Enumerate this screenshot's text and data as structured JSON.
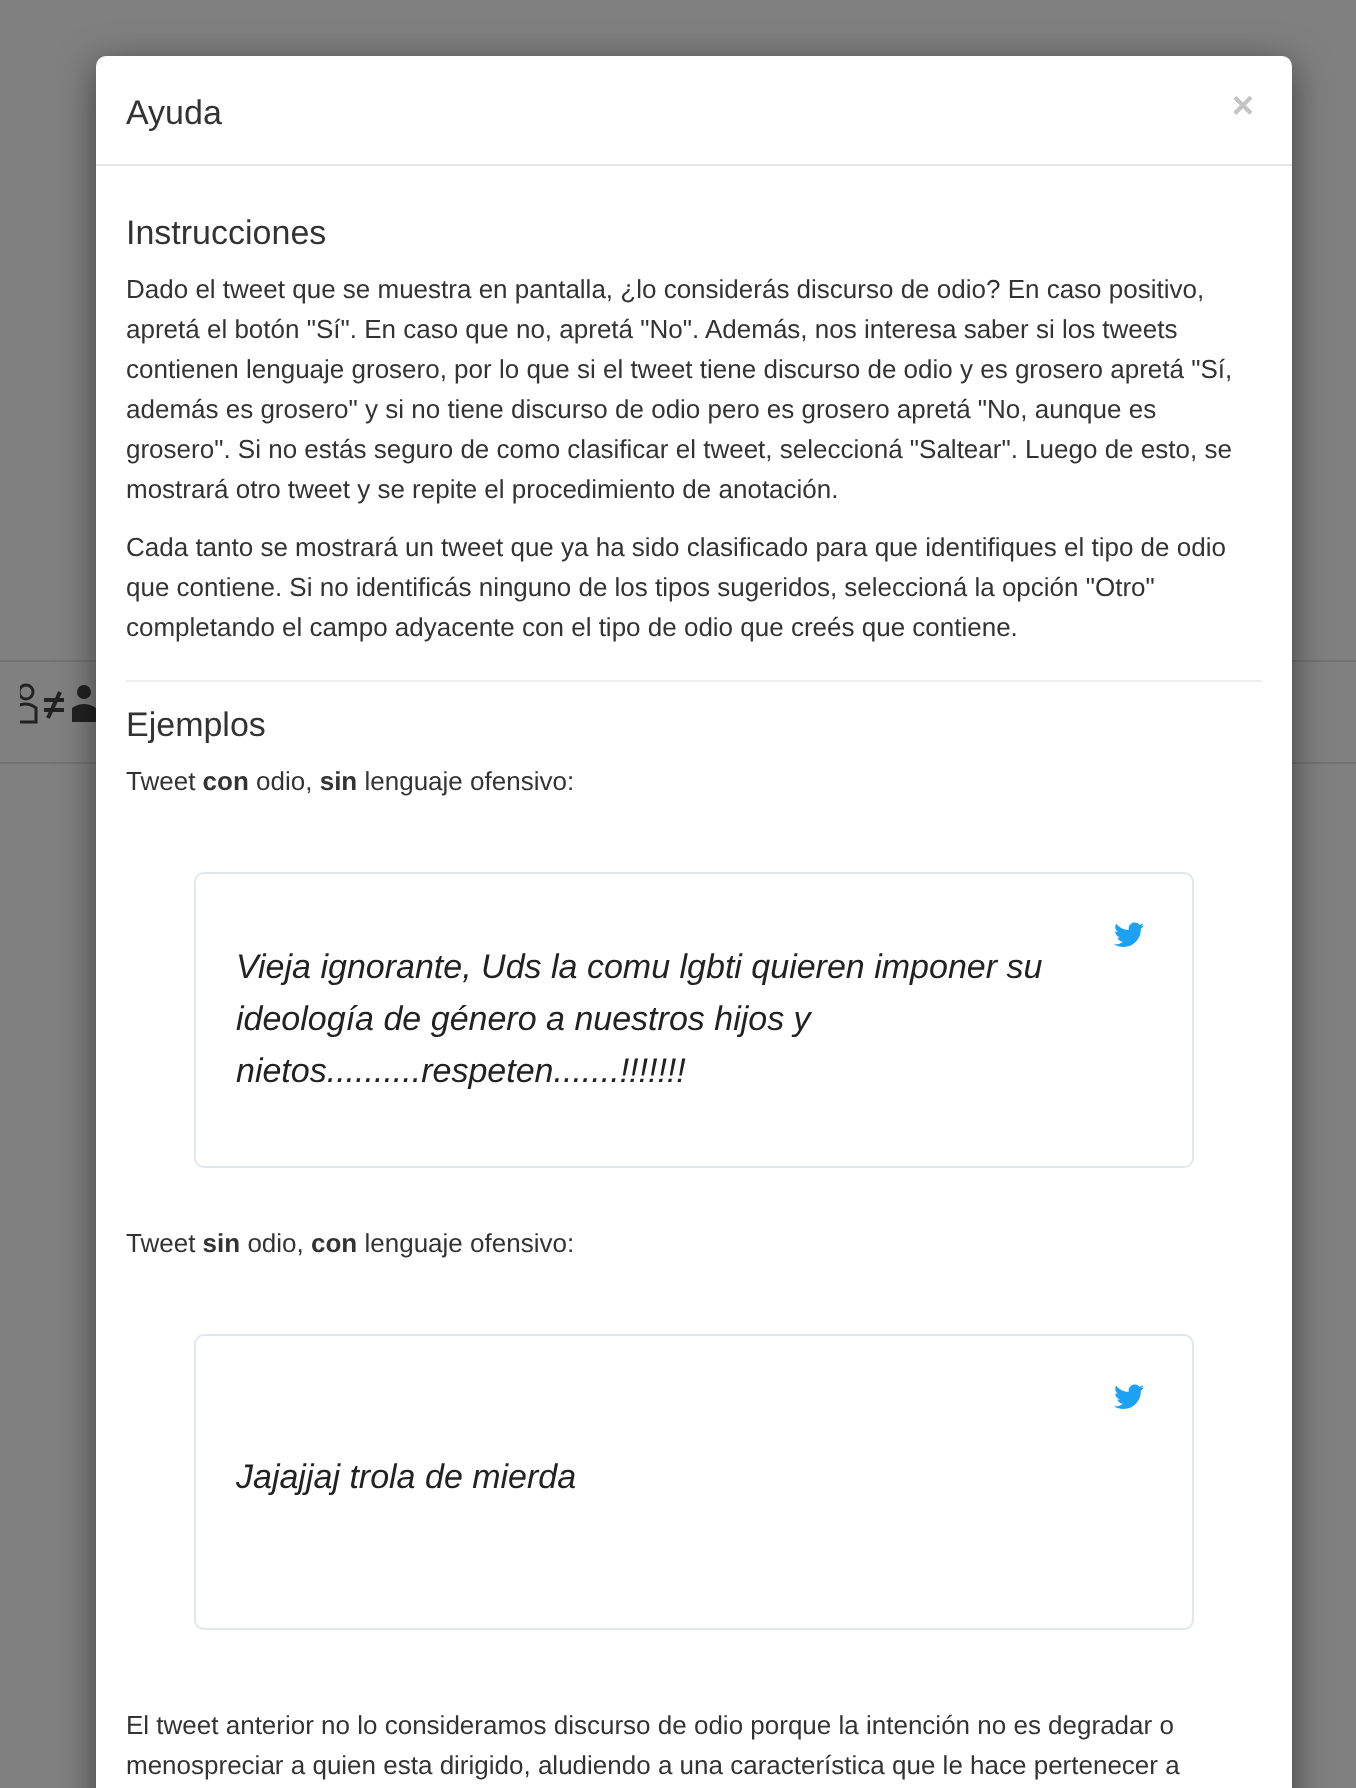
{
  "modal": {
    "title": "Ayuda",
    "close": "×"
  },
  "sections": [
    {
      "heading": "Instrucciones",
      "paragraphs": [
        "Dado el tweet que se muestra en pantalla, ¿lo considerás discurso de odio? En caso positivo, apretá el botón \"Sí\". En caso que no, apretá \"No\". Además, nos interesa saber si los tweets contienen lenguaje grosero, por lo que si el tweet tiene discurso de odio y es grosero apretá \"Sí, además es grosero\" y si no tiene discurso de odio pero es grosero apretá \"No, aunque es grosero\". Si no estás seguro de como clasificar el tweet, seleccioná \"Saltear\". Luego de esto, se mostrará otro tweet y se repite el procedimiento de anotación.",
        "Cada tanto se mostrará un tweet que ya ha sido clasificado para que identifiques el tipo de odio que contiene. Si no identificás ninguno de los tipos sugeridos, seleccioná la opción \"Otro\" completando el campo adyacente con el tipo de odio que creés que contiene."
      ]
    },
    {
      "heading": "Ejemplos",
      "examples": [
        {
          "caption": "Tweet **con** odio, **sin** lenguaje ofensivo:",
          "tweet": "Vieja ignorante, Uds la comu lgbti quieren imponer su ideología de género a nuestros hijos y nietos..........respeten.......!!!!!!!"
        },
        {
          "caption": "Tweet **sin** odio, **con** lenguaje ofensivo:",
          "tweet": "Jajajjaj trola de mierda"
        }
      ],
      "note": "El tweet anterior no lo consideramos discurso de odio porque la intención no es degradar o menospreciar a quien esta dirigido, aludiendo a una característica que le hace pertenecer a"
    }
  ]
}
